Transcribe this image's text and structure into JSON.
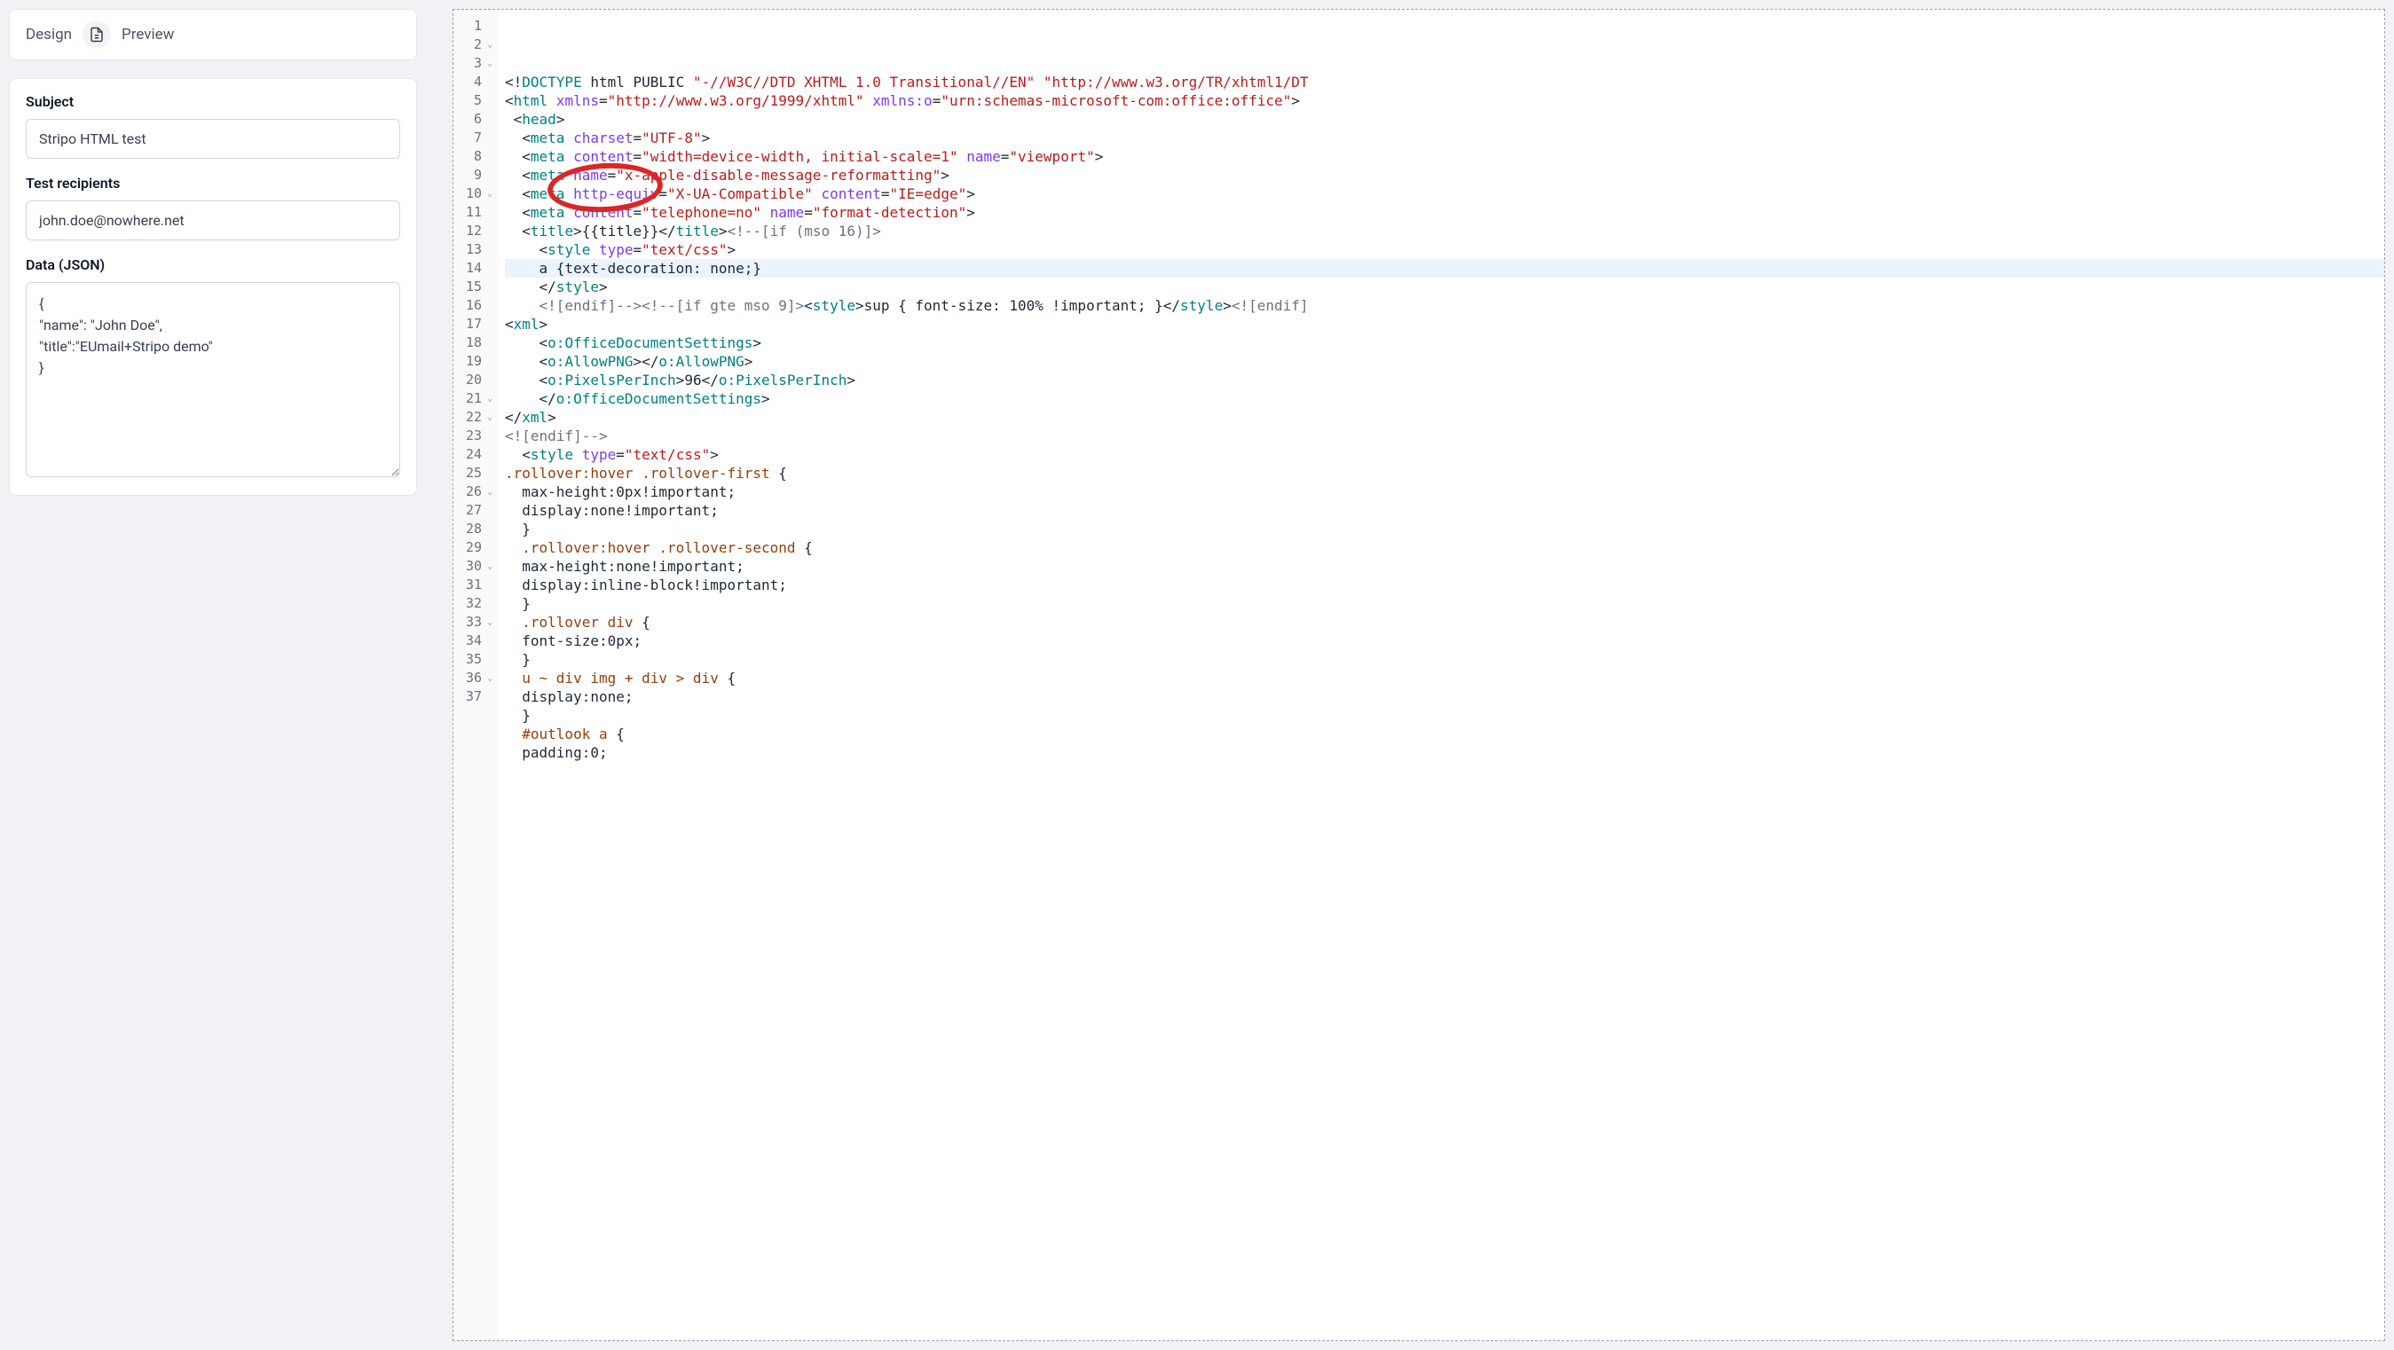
{
  "tabs": {
    "design": "Design",
    "preview": "Preview"
  },
  "form": {
    "subject_label": "Subject",
    "subject_value": "Stripo HTML test",
    "recipients_label": "Test recipients",
    "recipients_value": "john.doe@nowhere.net",
    "data_label": "Data (JSON)",
    "data_value": "{\n\"name\": \"John Doe\",\n\"title\":\"EUmail+Stripo demo\"\n}"
  },
  "editor": {
    "highlighted_line": 11,
    "lines": [
      {
        "n": 1,
        "fold": "",
        "t": [
          [
            "punc",
            "<!"
          ],
          [
            "tag",
            "DOCTYPE"
          ],
          [
            "text",
            " html PUBLIC "
          ],
          [
            "str",
            "\"-//W3C//DTD XHTML 1.0 Transitional//EN\""
          ],
          [
            "text",
            " "
          ],
          [
            "str",
            "\"http://www.w3.org/TR/xhtml1/DT"
          ]
        ]
      },
      {
        "n": 2,
        "fold": "v",
        "t": [
          [
            "punc",
            "<"
          ],
          [
            "tag",
            "html"
          ],
          [
            "text",
            " "
          ],
          [
            "attr",
            "xmlns"
          ],
          [
            "punc",
            "="
          ],
          [
            "str",
            "\"http://www.w3.org/1999/xhtml\""
          ],
          [
            "text",
            " "
          ],
          [
            "attr",
            "xmlns:o"
          ],
          [
            "punc",
            "="
          ],
          [
            "str",
            "\"urn:schemas-microsoft-com:office:office\""
          ],
          [
            "punc",
            ">"
          ]
        ]
      },
      {
        "n": 3,
        "fold": "v",
        "t": [
          [
            "text",
            " "
          ],
          [
            "punc",
            "<"
          ],
          [
            "tag",
            "head"
          ],
          [
            "punc",
            ">"
          ]
        ]
      },
      {
        "n": 4,
        "fold": "",
        "t": [
          [
            "text",
            "  "
          ],
          [
            "punc",
            "<"
          ],
          [
            "tag",
            "meta"
          ],
          [
            "text",
            " "
          ],
          [
            "attr",
            "charset"
          ],
          [
            "punc",
            "="
          ],
          [
            "str",
            "\"UTF-8\""
          ],
          [
            "punc",
            ">"
          ]
        ]
      },
      {
        "n": 5,
        "fold": "",
        "t": [
          [
            "text",
            "  "
          ],
          [
            "punc",
            "<"
          ],
          [
            "tag",
            "meta"
          ],
          [
            "text",
            " "
          ],
          [
            "attr",
            "content"
          ],
          [
            "punc",
            "="
          ],
          [
            "str",
            "\"width=device-width, initial-scale=1\""
          ],
          [
            "text",
            " "
          ],
          [
            "attr",
            "name"
          ],
          [
            "punc",
            "="
          ],
          [
            "str",
            "\"viewport\""
          ],
          [
            "punc",
            ">"
          ]
        ]
      },
      {
        "n": 6,
        "fold": "",
        "t": [
          [
            "text",
            "  "
          ],
          [
            "punc",
            "<"
          ],
          [
            "tag",
            "meta"
          ],
          [
            "text",
            " "
          ],
          [
            "attr",
            "name"
          ],
          [
            "punc",
            "="
          ],
          [
            "str",
            "\"x-apple-disable-message-reformatting\""
          ],
          [
            "punc",
            ">"
          ]
        ]
      },
      {
        "n": 7,
        "fold": "",
        "t": [
          [
            "text",
            "  "
          ],
          [
            "punc",
            "<"
          ],
          [
            "tag",
            "meta"
          ],
          [
            "text",
            " "
          ],
          [
            "attr",
            "http-equiv"
          ],
          [
            "punc",
            "="
          ],
          [
            "str",
            "\"X-UA-Compatible\""
          ],
          [
            "text",
            " "
          ],
          [
            "attr",
            "content"
          ],
          [
            "punc",
            "="
          ],
          [
            "str",
            "\"IE=edge\""
          ],
          [
            "punc",
            ">"
          ]
        ]
      },
      {
        "n": 8,
        "fold": "",
        "t": [
          [
            "text",
            "  "
          ],
          [
            "punc",
            "<"
          ],
          [
            "tag",
            "meta"
          ],
          [
            "text",
            " "
          ],
          [
            "attr",
            "content"
          ],
          [
            "punc",
            "="
          ],
          [
            "str",
            "\"telephone=no\""
          ],
          [
            "text",
            " "
          ],
          [
            "attr",
            "name"
          ],
          [
            "punc",
            "="
          ],
          [
            "str",
            "\"format-detection\""
          ],
          [
            "punc",
            ">"
          ]
        ]
      },
      {
        "n": 9,
        "fold": "",
        "t": [
          [
            "text",
            "  "
          ],
          [
            "punc",
            "<"
          ],
          [
            "tag",
            "title"
          ],
          [
            "punc",
            ">"
          ],
          [
            "text",
            "{{title}}"
          ],
          [
            "punc",
            "</"
          ],
          [
            "tag",
            "title"
          ],
          [
            "punc",
            ">"
          ],
          [
            "comment",
            "<!--[if (mso 16)]>"
          ]
        ]
      },
      {
        "n": 10,
        "fold": "v",
        "t": [
          [
            "text",
            "    "
          ],
          [
            "punc",
            "<"
          ],
          [
            "tag",
            "style"
          ],
          [
            "text",
            " "
          ],
          [
            "attr",
            "type"
          ],
          [
            "punc",
            "="
          ],
          [
            "str",
            "\"text/css\""
          ],
          [
            "punc",
            ">"
          ]
        ]
      },
      {
        "n": 11,
        "fold": "",
        "t": [
          [
            "text",
            "    a {text-decoration: none;}"
          ]
        ]
      },
      {
        "n": 12,
        "fold": "",
        "t": [
          [
            "text",
            "    "
          ],
          [
            "punc",
            "</"
          ],
          [
            "tag",
            "style"
          ],
          [
            "punc",
            ">"
          ]
        ]
      },
      {
        "n": 13,
        "fold": "",
        "t": [
          [
            "text",
            "    "
          ],
          [
            "comment",
            "<![endif]-->"
          ],
          [
            "comment",
            "<!--[if gte mso 9]>"
          ],
          [
            "punc",
            "<"
          ],
          [
            "tag",
            "style"
          ],
          [
            "punc",
            ">"
          ],
          [
            "text",
            "sup { font-size: 100% !important; }"
          ],
          [
            "punc",
            "</"
          ],
          [
            "tag",
            "style"
          ],
          [
            "punc",
            ">"
          ],
          [
            "comment",
            "<![endif]"
          ]
        ]
      },
      {
        "n": 14,
        "fold": "",
        "t": [
          [
            "punc",
            "<"
          ],
          [
            "tag",
            "xml"
          ],
          [
            "punc",
            ">"
          ]
        ]
      },
      {
        "n": 15,
        "fold": "",
        "t": [
          [
            "text",
            "    "
          ],
          [
            "punc",
            "<"
          ],
          [
            "tag",
            "o:OfficeDocumentSettings"
          ],
          [
            "punc",
            ">"
          ]
        ]
      },
      {
        "n": 16,
        "fold": "",
        "t": [
          [
            "text",
            "    "
          ],
          [
            "punc",
            "<"
          ],
          [
            "tag",
            "o:AllowPNG"
          ],
          [
            "punc",
            "></"
          ],
          [
            "tag",
            "o:AllowPNG"
          ],
          [
            "punc",
            ">"
          ]
        ]
      },
      {
        "n": 17,
        "fold": "",
        "t": [
          [
            "text",
            "    "
          ],
          [
            "punc",
            "<"
          ],
          [
            "tag",
            "o:PixelsPerInch"
          ],
          [
            "punc",
            ">"
          ],
          [
            "text",
            "96"
          ],
          [
            "punc",
            "</"
          ],
          [
            "tag",
            "o:PixelsPerInch"
          ],
          [
            "punc",
            ">"
          ]
        ]
      },
      {
        "n": 18,
        "fold": "",
        "t": [
          [
            "text",
            "    "
          ],
          [
            "punc",
            "</"
          ],
          [
            "tag",
            "o:OfficeDocumentSettings"
          ],
          [
            "punc",
            ">"
          ]
        ]
      },
      {
        "n": 19,
        "fold": "",
        "t": [
          [
            "punc",
            "</"
          ],
          [
            "tag",
            "xml"
          ],
          [
            "punc",
            ">"
          ]
        ]
      },
      {
        "n": 20,
        "fold": "",
        "t": [
          [
            "comment",
            "<![endif]-->"
          ]
        ]
      },
      {
        "n": 21,
        "fold": "v",
        "t": [
          [
            "text",
            "  "
          ],
          [
            "punc",
            "<"
          ],
          [
            "tag",
            "style"
          ],
          [
            "text",
            " "
          ],
          [
            "attr",
            "type"
          ],
          [
            "punc",
            "="
          ],
          [
            "str",
            "\"text/css\""
          ],
          [
            "punc",
            ">"
          ]
        ]
      },
      {
        "n": 22,
        "fold": "v",
        "t": [
          [
            "brown",
            ".rollover:hover .rollover-first"
          ],
          [
            "text",
            " {"
          ]
        ]
      },
      {
        "n": 23,
        "fold": "",
        "t": [
          [
            "text",
            "  max-height:0px!important;"
          ]
        ]
      },
      {
        "n": 24,
        "fold": "",
        "t": [
          [
            "text",
            "  display:none!important;"
          ]
        ]
      },
      {
        "n": 25,
        "fold": "",
        "t": [
          [
            "text",
            "  }"
          ]
        ]
      },
      {
        "n": 26,
        "fold": "v",
        "t": [
          [
            "text",
            "  "
          ],
          [
            "brown",
            ".rollover:hover .rollover-second"
          ],
          [
            "text",
            " {"
          ]
        ]
      },
      {
        "n": 27,
        "fold": "",
        "t": [
          [
            "text",
            "  max-height:none!important;"
          ]
        ]
      },
      {
        "n": 28,
        "fold": "",
        "t": [
          [
            "text",
            "  display:inline-block!important;"
          ]
        ]
      },
      {
        "n": 29,
        "fold": "",
        "t": [
          [
            "text",
            "  }"
          ]
        ]
      },
      {
        "n": 30,
        "fold": "v",
        "t": [
          [
            "text",
            "  "
          ],
          [
            "brown",
            ".rollover div"
          ],
          [
            "text",
            " {"
          ]
        ]
      },
      {
        "n": 31,
        "fold": "",
        "t": [
          [
            "text",
            "  font-size:0px;"
          ]
        ]
      },
      {
        "n": 32,
        "fold": "",
        "t": [
          [
            "text",
            "  }"
          ]
        ]
      },
      {
        "n": 33,
        "fold": "v",
        "t": [
          [
            "text",
            "  "
          ],
          [
            "brown",
            "u ~ div img + div > div"
          ],
          [
            "text",
            " {"
          ]
        ]
      },
      {
        "n": 34,
        "fold": "",
        "t": [
          [
            "text",
            "  display:none;"
          ]
        ]
      },
      {
        "n": 35,
        "fold": "",
        "t": [
          [
            "text",
            "  }"
          ]
        ]
      },
      {
        "n": 36,
        "fold": "v",
        "t": [
          [
            "text",
            "  "
          ],
          [
            "brown",
            "#outlook a"
          ],
          [
            "text",
            " {"
          ]
        ]
      },
      {
        "n": 37,
        "fold": "",
        "t": [
          [
            "text",
            "  padding:0;"
          ]
        ]
      }
    ]
  }
}
